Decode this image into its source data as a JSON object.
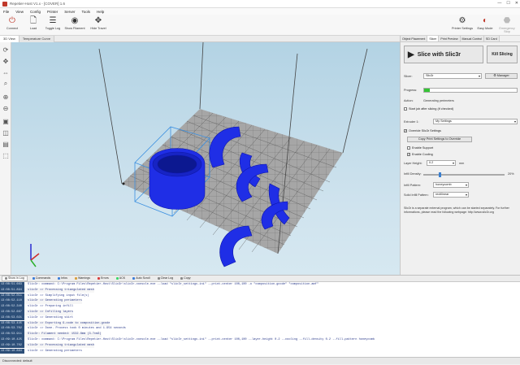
{
  "window": {
    "title": "Repetier-Host V1.x - [COVER] 1.6",
    "controls": [
      "—",
      "☐",
      "✕"
    ]
  },
  "menu": [
    "File",
    "View",
    "Config",
    "Printer",
    "Server",
    "Tools",
    "Help"
  ],
  "toolbar": {
    "left": [
      {
        "label": "Connect",
        "icon": "power-icon",
        "glyph": "⏻",
        "color": "#c0392b"
      },
      {
        "label": "Load",
        "icon": "load-icon",
        "glyph": "🗋",
        "color": "#555555"
      },
      {
        "label": "Toggle Log",
        "icon": "log-icon",
        "glyph": "☰",
        "color": "#555555"
      },
      {
        "label": "Show Filament",
        "icon": "filament-icon",
        "glyph": "◉",
        "color": "#555555"
      },
      {
        "label": "Hide Travel",
        "icon": "travel-icon",
        "glyph": "✥",
        "color": "#555555"
      }
    ],
    "right": [
      {
        "label": "Printer Settings",
        "icon": "printer-settings-icon",
        "glyph": "⚙",
        "color": "#555555"
      },
      {
        "label": "Easy Mode",
        "icon": "easy-mode-icon",
        "glyph": "◐",
        "color": "#c0392b"
      },
      {
        "label": "Emergency Stop",
        "icon": "emergency-stop-icon",
        "glyph": "⬣",
        "color": "#bbbbbb"
      }
    ]
  },
  "view_tabs": [
    "3D View",
    "Temperature Curve"
  ],
  "right_tabs": [
    "Object Placement",
    "Slicer",
    "Print Preview",
    "Manual Control",
    "SD Card"
  ],
  "slicer": {
    "slice_button": "Slice with Slic3r",
    "kill_button": "Kill Slicing",
    "slicer_label": "Slicer:",
    "slicer_value": "Slic3r",
    "manager_button": "Manager",
    "progress_label": "Progress:",
    "progress_fraction": 0.06,
    "action_label": "Action:",
    "action_value": "Generating perimeters",
    "start_after_label": "Start job after slicing (if checked)",
    "extruder_label": "Extruder 1:",
    "extruder_value": "My Settings",
    "override_label": "Override Slic3r Settings",
    "copy_button": "Copy Print Settings to Override",
    "enable_support": "Enable Support",
    "enable_cooling": "Enable Cooling",
    "layer_height_label": "Layer Height:",
    "layer_height_value": "0.2",
    "layer_height_unit": "mm",
    "infill_density_label": "Infill Density:",
    "infill_density_value": "20%",
    "infill_density_fraction": 0.2,
    "infill_pattern_label": "Infill Pattern:",
    "infill_pattern_value": "honeycomb",
    "solid_infill_label": "Solid Infill Pattern:",
    "solid_infill_value": "rectilinear",
    "help_text": "Slic3r is a separate external program, which can be started separately. For further informations, please read the following webpage: http://www.slic3r.org"
  },
  "log_tabs": [
    {
      "label": "Show in Log",
      "color": "#888888",
      "active": true
    },
    {
      "label": "Commands",
      "color": "#3b7dd8",
      "active": false
    },
    {
      "label": "Infos",
      "color": "#3b7dd8",
      "active": false
    },
    {
      "label": "Warnings",
      "color": "#d8a03b",
      "active": false
    },
    {
      "label": "Errors",
      "color": "#d83b3b",
      "active": false
    },
    {
      "label": "ACK",
      "color": "#3bd86a",
      "active": false
    },
    {
      "label": "Auto Scroll",
      "color": "#3b7dd8",
      "active": false
    },
    {
      "label": "Clear Log",
      "color": "#888888",
      "active": false
    },
    {
      "label": "Copy",
      "color": "#888888",
      "active": false
    }
  ],
  "log": [
    {
      "time": "13:08:51.663",
      "msg": "Slic3r: command: C:\\Program Files\\Repetier-Host\\Slic3r\\slic3r-console.exe --load \"slic3r_settings.ini\" --print-center 100,100 -o \"composition.gcode\" \"composition.amf\""
    },
    {
      "time": "13:08:51.894",
      "msg": "slic3r => Processing triangulated mesh"
    },
    {
      "time": "13:08:52.011",
      "msg": "slic3r => Simplifying input file(s)"
    },
    {
      "time": "13:08:52.110",
      "msg": "slic3r => Generating perimeters"
    },
    {
      "time": "13:08:52.340",
      "msg": "slic3r => Preparing infill"
    },
    {
      "time": "13:08:52.667",
      "msg": "slic3r => Infilling layers"
    },
    {
      "time": "13:08:53.021",
      "msg": "slic3r => Generating skirt"
    },
    {
      "time": "13:08:53.445",
      "msg": "slic3r => Exporting G-code to composition.gcode"
    },
    {
      "time": "13:08:53.702",
      "msg": "slic3r => Done. Process took 0 minutes and 1.954 seconds"
    },
    {
      "time": "13:08:53.911",
      "msg": "Slic3r: Filament needed: 1532.8mm (3.7cm3)"
    },
    {
      "time": "13:09:10.425",
      "msg": "Slic3r: command: C:\\Program Files\\Repetier-Host\\Slic3r\\slic3r-console.exe --load \"slic3r_settings.ini\" --print-center 100,100 --layer-height 0.2 --cooling --fill-density 0.2 --fill-pattern honeycomb"
    },
    {
      "time": "13:09:10.702",
      "msg": "slic3r => Processing triangulated mesh"
    },
    {
      "time": "13:09:10.884",
      "msg": "slic3r => Generating perimeters"
    }
  ],
  "status": "Disconnected: default"
}
